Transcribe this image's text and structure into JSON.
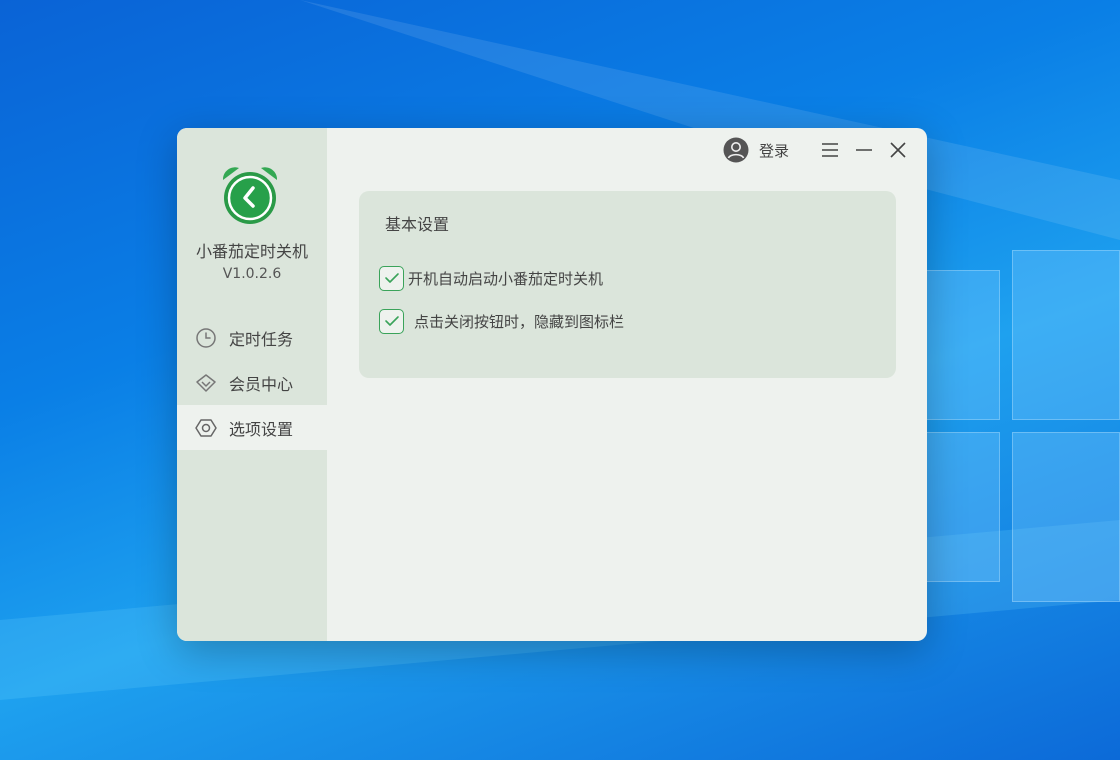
{
  "app": {
    "name": "小番茄定时关机",
    "version": "V1.0.2.6",
    "accent_color": "#3aa35a"
  },
  "titlebar": {
    "login_label": "登录",
    "icons": [
      "user-icon",
      "menu-icon",
      "minimize-icon",
      "close-icon"
    ]
  },
  "sidebar": {
    "items": [
      {
        "label": "定时任务",
        "icon": "clock-icon",
        "active": false
      },
      {
        "label": "会员中心",
        "icon": "diamond-icon",
        "active": false
      },
      {
        "label": "选项设置",
        "icon": "gear-icon",
        "active": true
      }
    ]
  },
  "settings": {
    "section_title": "基本设置",
    "options": [
      {
        "label": "开机自动启动小番茄定时关机",
        "checked": true
      },
      {
        "label": "点击关闭按钮时，隐藏到图标栏",
        "checked": true
      }
    ]
  }
}
